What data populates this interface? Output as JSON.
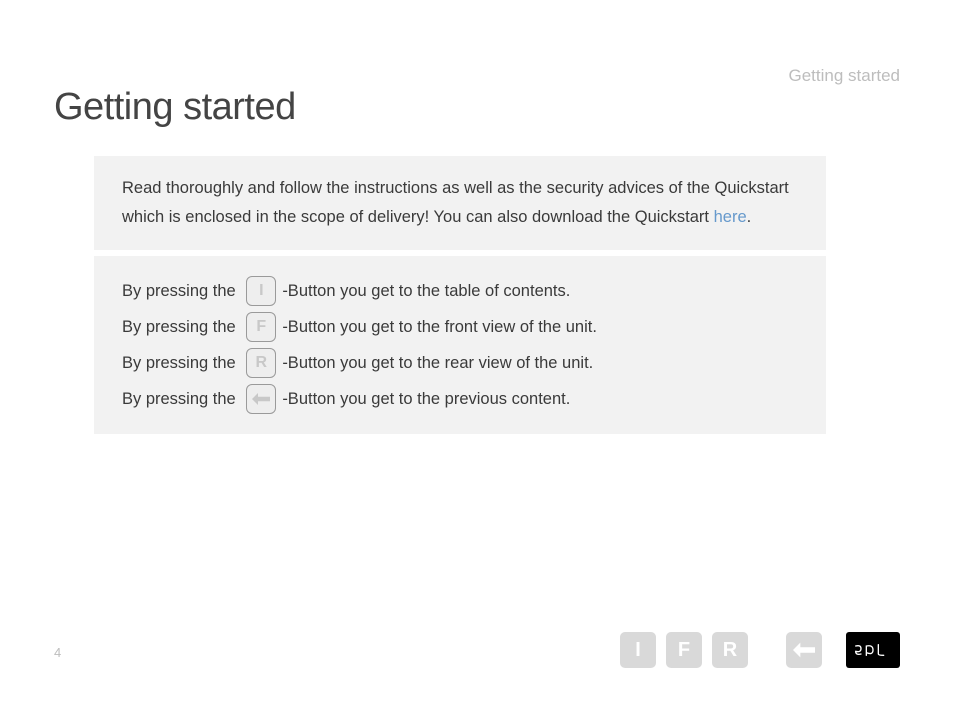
{
  "header": {
    "running_title": "Getting started"
  },
  "title": "Getting started",
  "intro": {
    "text_before_link": "Read thoroughly and follow the instructions as well as the security advices of the Quickstart which is enclosed in the scope of delivery! You can also download the Quickstart ",
    "link_text": "here",
    "text_after_link": "."
  },
  "instructions": [
    {
      "pre": "By pressing the ",
      "key": "I",
      "post": "-Button you get to the table of contents."
    },
    {
      "pre": "By pressing the ",
      "key": "F",
      "post": "-Button you get to the front view of the unit."
    },
    {
      "pre": "By pressing the ",
      "key": "R",
      "post": "-Button you get to the rear view of the unit."
    },
    {
      "pre": "By pressing the ",
      "key": "back",
      "post": "-Button you get to the previous content."
    }
  ],
  "footer": {
    "page_number": "4",
    "nav": {
      "i": "I",
      "f": "F",
      "r": "R"
    },
    "logo_text": "spl"
  }
}
